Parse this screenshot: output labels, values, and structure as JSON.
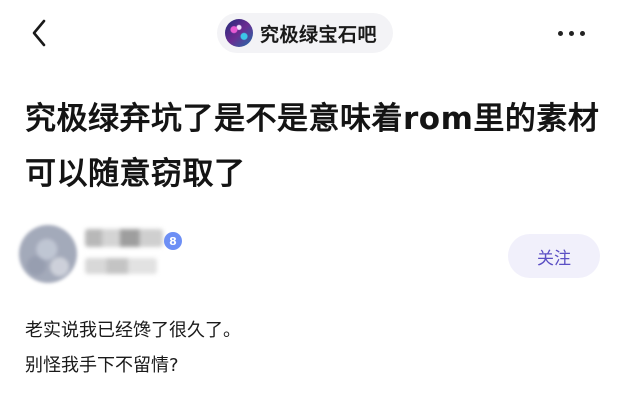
{
  "header": {
    "forum_name": "究极绿宝石吧",
    "back_icon": "chevron-left-icon",
    "more_icon": "more-horizontal-icon"
  },
  "post": {
    "title": "究极绿弃坑了是不是意味着rom里的素材可以随意窃取了",
    "author": {
      "name": "",
      "meta": "",
      "level": "8"
    },
    "follow_label": "关注",
    "body_lines": [
      "老实说我已经馋了很久了。",
      "别怪我手下不留情?"
    ]
  },
  "colors": {
    "accent": "#5b4fc4",
    "follow_bg": "#f1f0fb",
    "chip_bg": "#f3f3f6",
    "level_badge": "#6d8ff5"
  }
}
